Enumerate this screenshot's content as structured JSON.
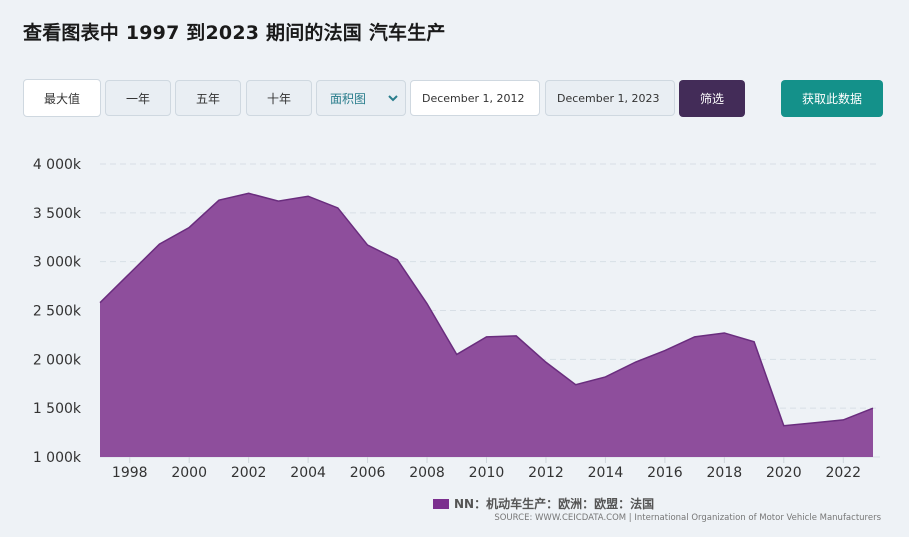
{
  "title": "查看图表中 1997 到2023 期间的法国 汽车生产",
  "toolbar": {
    "range_buttons": [
      "最大值",
      "一年",
      "五年",
      "十年"
    ],
    "chart_type_value": "面积图",
    "start_date": "December 1, 2012",
    "end_date": "December 1, 2023",
    "filter_label": "筛选",
    "get_data_label": "获取此数据"
  },
  "colors": {
    "area_fill": "#8e4e9c",
    "area_stroke": "#6a2d7e",
    "filter_button": "#432c58",
    "get_data_button": "#14918a",
    "legend_swatch": "#7b2f8e"
  },
  "legend_label": "NN：机动车生产：欧洲：欧盟：法国",
  "source_text": "SOURCE: WWW.CEICDATA.COM | International Organization of Motor Vehicle Manufacturers",
  "chart_data": {
    "type": "area",
    "title": "",
    "xlabel": "",
    "ylabel": "",
    "x": [
      1997,
      1998,
      1999,
      2000,
      2001,
      2002,
      2003,
      2004,
      2005,
      2006,
      2007,
      2008,
      2009,
      2010,
      2011,
      2012,
      2013,
      2014,
      2015,
      2016,
      2017,
      2018,
      2019,
      2020,
      2021,
      2022,
      2023
    ],
    "series": [
      {
        "name": "NN：机动车生产：欧洲：欧盟：法国",
        "values": [
          2580000,
          2880000,
          3180000,
          3350000,
          3630000,
          3700000,
          3620000,
          3670000,
          3550000,
          3170000,
          3020000,
          2570000,
          2050000,
          2230000,
          2240000,
          1970000,
          1740000,
          1820000,
          1970000,
          2090000,
          2230000,
          2270000,
          2180000,
          1320000,
          1350000,
          1380000,
          1500000
        ]
      }
    ],
    "ylim": [
      1000000,
      4000000
    ],
    "yticks": [
      1000000,
      1500000,
      2000000,
      2500000,
      3000000,
      3500000,
      4000000
    ],
    "ytick_labels": [
      "1 000k",
      "1 500k",
      "2 000k",
      "2 500k",
      "3 000k",
      "3 500k",
      "4 000k"
    ],
    "xticks": [
      1998,
      2000,
      2002,
      2004,
      2006,
      2008,
      2010,
      2012,
      2014,
      2016,
      2018,
      2020,
      2022
    ],
    "xtick_labels": [
      "1998",
      "2000",
      "2002",
      "2004",
      "2006",
      "2008",
      "2010",
      "2012",
      "2014",
      "2016",
      "2018",
      "2020",
      "2022"
    ],
    "grid": true,
    "legend_position": "bottom-center"
  }
}
